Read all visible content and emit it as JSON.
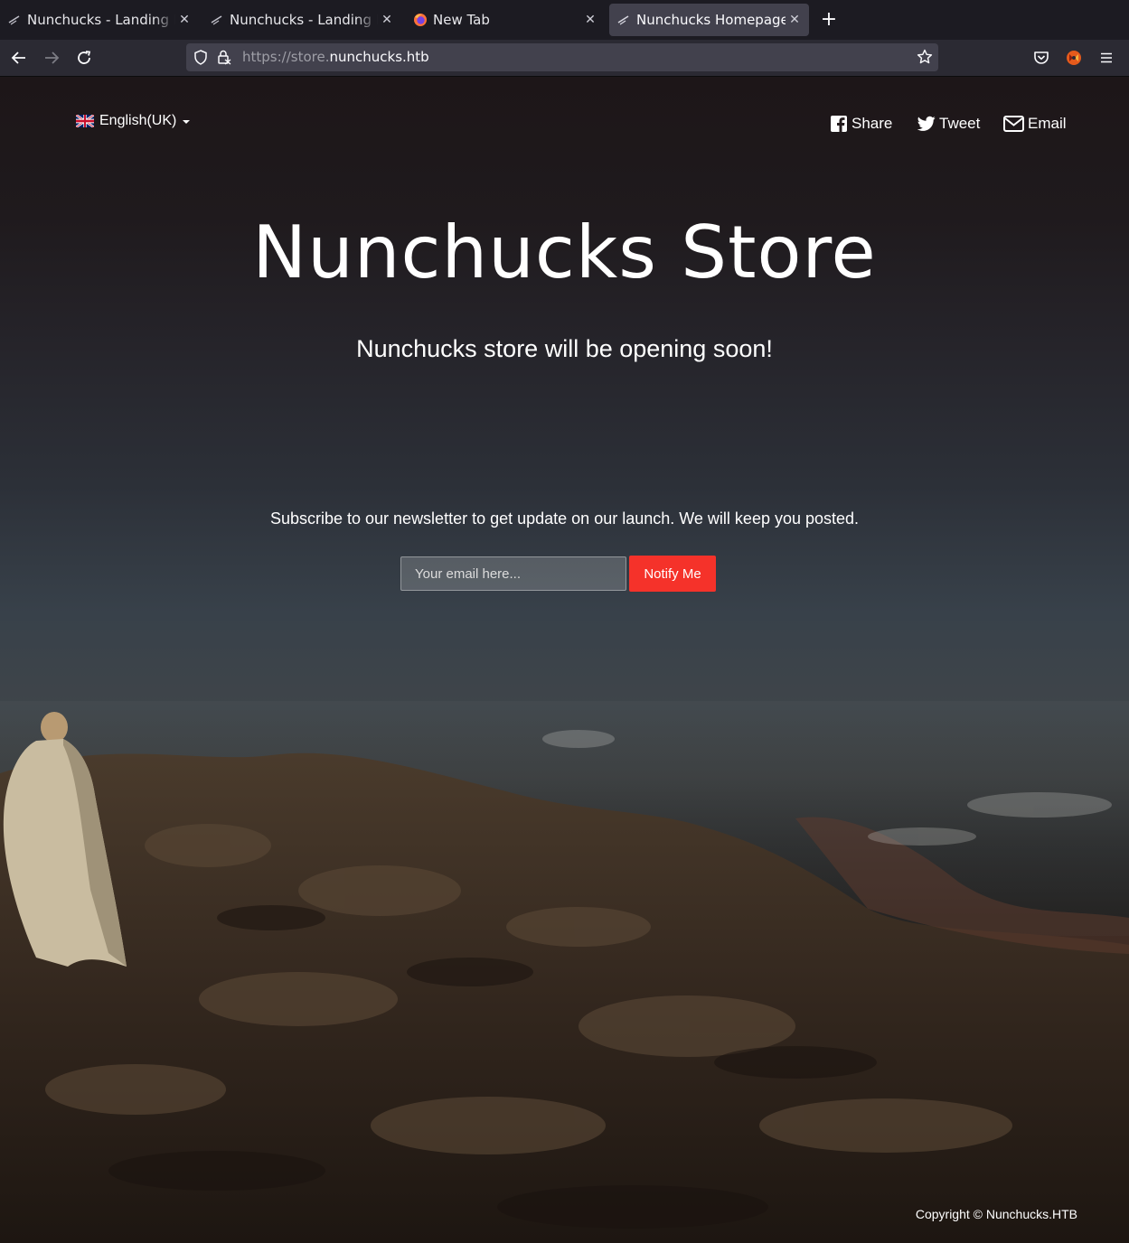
{
  "browser": {
    "tabs": [
      {
        "title": "Nunchucks - Landing Page",
        "icon": "nunchuck-favicon-icon",
        "active": false
      },
      {
        "title": "Nunchucks - Landing Page",
        "icon": "nunchuck-favicon-icon",
        "active": false
      },
      {
        "title": "New Tab",
        "icon": "firefox-icon",
        "active": false
      },
      {
        "title": "Nunchucks Homepage",
        "icon": "nunchuck-favicon-icon",
        "active": true
      }
    ],
    "new_tab_label": "+",
    "url_prefix": "https://store.",
    "url_domain": "nunchucks.htb"
  },
  "page": {
    "language": "English(UK)",
    "social": {
      "share": "Share",
      "tweet": "Tweet",
      "email": "Email"
    },
    "title": "Nunchucks Store",
    "subtitle": "Nunchucks store will be opening soon!",
    "newsletter_text": "Subscribe to our newsletter to get update on our launch. We will keep you posted.",
    "email_placeholder": "Your email here...",
    "notify_label": "Notify Me",
    "copyright": "Copyright © Nunchucks.HTB"
  },
  "colors": {
    "accent": "#f5322a",
    "chrome_dark": "#1c1b22",
    "chrome_bar": "#2b2a33"
  }
}
